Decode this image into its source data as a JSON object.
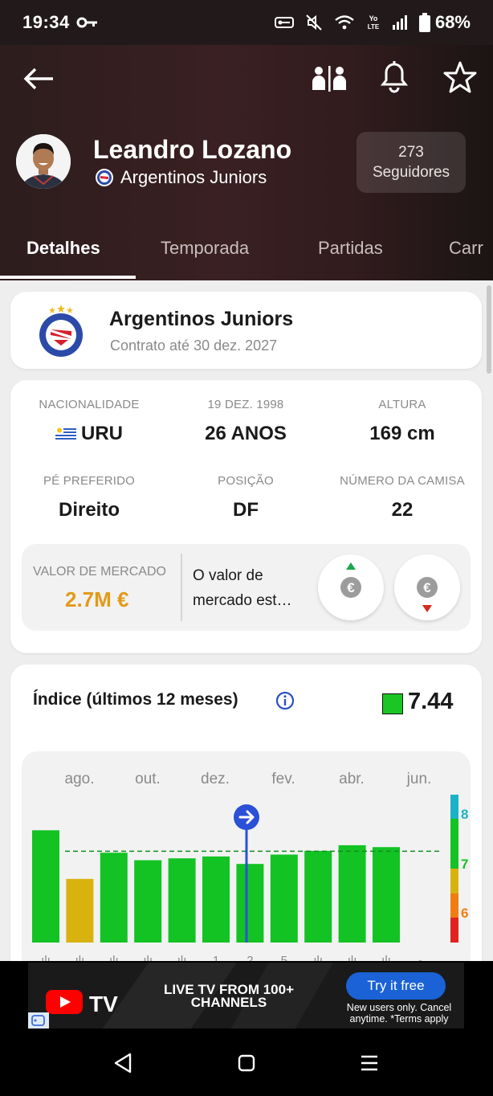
{
  "status_bar": {
    "time": "19:34",
    "battery": "68%",
    "icons": [
      "key-icon",
      "vpn-key-icon",
      "mute-icon",
      "wifi-icon",
      "volte-icon",
      "signal-icon",
      "battery-icon"
    ]
  },
  "toolbar": {
    "icons": [
      "back-arrow-icon",
      "compare-icon",
      "bell-icon",
      "star-icon"
    ]
  },
  "player": {
    "name": "Leandro Lozano",
    "club": "Argentinos Juniors",
    "followers_count": "273",
    "followers_label": "Seguidores"
  },
  "tabs": [
    {
      "label": "Detalhes",
      "active": true
    },
    {
      "label": "Temporada",
      "active": false
    },
    {
      "label": "Partidas",
      "active": false
    },
    {
      "label": "Carr",
      "active": false
    }
  ],
  "club_card": {
    "name": "Argentinos Juniors",
    "contract": "Contrato até 30 dez. 2027"
  },
  "details": [
    {
      "label": "NACIONALIDADE",
      "value": "URU"
    },
    {
      "label": "19 DEZ. 1998",
      "value": "26 ANOS"
    },
    {
      "label": "ALTURA",
      "value": "169 cm"
    },
    {
      "label": "PÉ PREFERIDO",
      "value": "Direito"
    },
    {
      "label": "POSIÇÃO",
      "value": "DF"
    },
    {
      "label": "NÚMERO DA CAMISA",
      "value": "22"
    }
  ],
  "market": {
    "label": "VALOR DE MERCADO",
    "value": "2.7M €",
    "description_line1": "O valor de",
    "description_line2": "mercado est…",
    "value_color": "#e29a17"
  },
  "index": {
    "title": "Índice (últimos 12 meses)",
    "rating": "7.44",
    "rating_color": "#1bc524"
  },
  "chart_data": {
    "type": "bar",
    "x_tick_labels": [
      "ago.",
      "out.",
      "dez.",
      "fev.",
      "abr.",
      "jun."
    ],
    "values": [
      8.0,
      6.7,
      7.4,
      7.2,
      7.25,
      7.3,
      7.1,
      7.35,
      7.45,
      7.6,
      7.55
    ],
    "bar_colors": [
      "#13c324",
      "#d8b20e",
      "#13c324",
      "#13c324",
      "#13c324",
      "#13c324",
      "#13c324",
      "#13c324",
      "#13c324",
      "#13c324",
      "#13c324"
    ],
    "average": 7.44,
    "y_scale_labels": [
      "8",
      "7",
      "6"
    ],
    "scale_colors": [
      "#1ab2c9",
      "#13c324",
      "#d8b20e",
      "#f07c12",
      "#e0231c"
    ],
    "bottom_labels": [
      "ılı",
      "ılı",
      "ılı",
      "ılı",
      "ılı",
      "1",
      "2",
      "5",
      "ılı",
      "ılı",
      "ılı",
      "-"
    ],
    "ylim": [
      5.0,
      8.5
    ],
    "grid": false
  },
  "ad": {
    "brand": "TV",
    "headline": "LIVE TV FROM 100+ CHANNELS",
    "cta": "Try it free",
    "subtext": "New users only. Cancel anytime. *Terms apply"
  },
  "nav": {
    "icons": [
      "back-triangle-icon",
      "home-square-icon",
      "menu-lines-icon"
    ]
  }
}
